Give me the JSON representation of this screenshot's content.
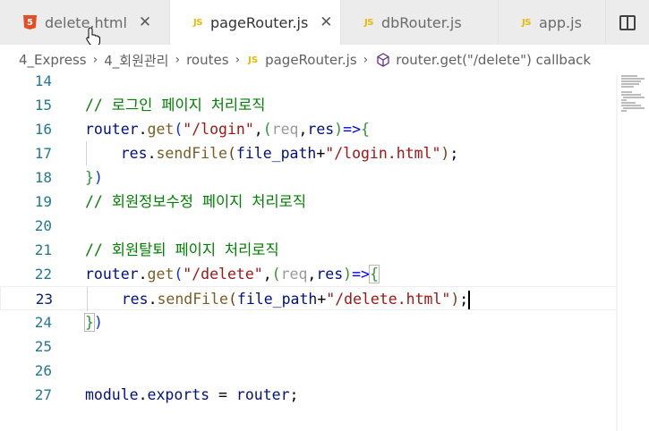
{
  "tabs": [
    {
      "label": "delete.html",
      "icon": "html5-icon",
      "active": false,
      "closable": true
    },
    {
      "label": "pageRouter.js",
      "icon": "js-icon",
      "active": true,
      "closable": true
    },
    {
      "label": "dbRouter.js",
      "icon": "js-icon",
      "active": false,
      "closable": false
    },
    {
      "label": "app.js",
      "icon": "js-icon",
      "active": false,
      "closable": false
    }
  ],
  "tab_close_glyph": "✕",
  "js_badge": "JS",
  "html_badge": "5",
  "breadcrumb": {
    "items": [
      "4_Express",
      "4_회원관리",
      "routes",
      "pageRouter.js",
      "router.get(\"/delete\") callback"
    ],
    "separator": "›"
  },
  "editor": {
    "line_numbers": [
      "14",
      "15",
      "16",
      "17",
      "18",
      "19",
      "20",
      "21",
      "22",
      "23",
      "24",
      "25",
      "26",
      "27"
    ],
    "current_line": "23",
    "lines": {
      "l15_comment": "// 로그인 페이지 처리로직",
      "l16_router": "router",
      "l16_dot": ".",
      "l16_get": "get",
      "l16_open": "(",
      "l16_path": "\"/login\"",
      "l16_comma": ",",
      "l16_popen": "(",
      "l16_req": "req",
      "l16_comma2": ",",
      "l16_res": "res",
      "l16_pclose": ")",
      "l16_arrow": "=>",
      "l16_brace": "{",
      "l17_indent": "    ",
      "l17_res": "res",
      "l17_dot": ".",
      "l17_fn": "sendFile",
      "l17_open": "(",
      "l17_var": "file_path",
      "l17_plus": "+",
      "l17_str": "\"/login.html\"",
      "l17_close": ")",
      "l17_semi": ";",
      "l18_brace": "}",
      "l18_paren": ")",
      "l19_comment": "// 회원정보수정 페이지 처리로직",
      "l21_comment": "// 회원탈퇴 페이지 처리로직",
      "l22_router": "router",
      "l22_dot": ".",
      "l22_get": "get",
      "l22_open": "(",
      "l22_path": "\"/delete\"",
      "l22_comma": ",",
      "l22_popen": "(",
      "l22_req": "req",
      "l22_comma2": ",",
      "l22_res": "res",
      "l22_pclose": ")",
      "l22_arrow": "=>",
      "l22_brace": "{",
      "l23_indent": "    ",
      "l23_res": "res",
      "l23_dot": ".",
      "l23_fn": "sendFile",
      "l23_open": "(",
      "l23_var": "file_path",
      "l23_plus": "+",
      "l23_str": "\"/delete.html\"",
      "l23_close": ")",
      "l23_semi": ";",
      "l24_brace": "}",
      "l24_paren": ")",
      "l27_module": "module",
      "l27_dot": ".",
      "l27_exports": "exports",
      "l27_eq": " = ",
      "l27_router": "router",
      "l27_semi": ";"
    }
  },
  "colors": {
    "comment": "#008000",
    "string": "#a31515",
    "function": "#795e26",
    "variable": "#001080",
    "line_number": "#237893"
  }
}
